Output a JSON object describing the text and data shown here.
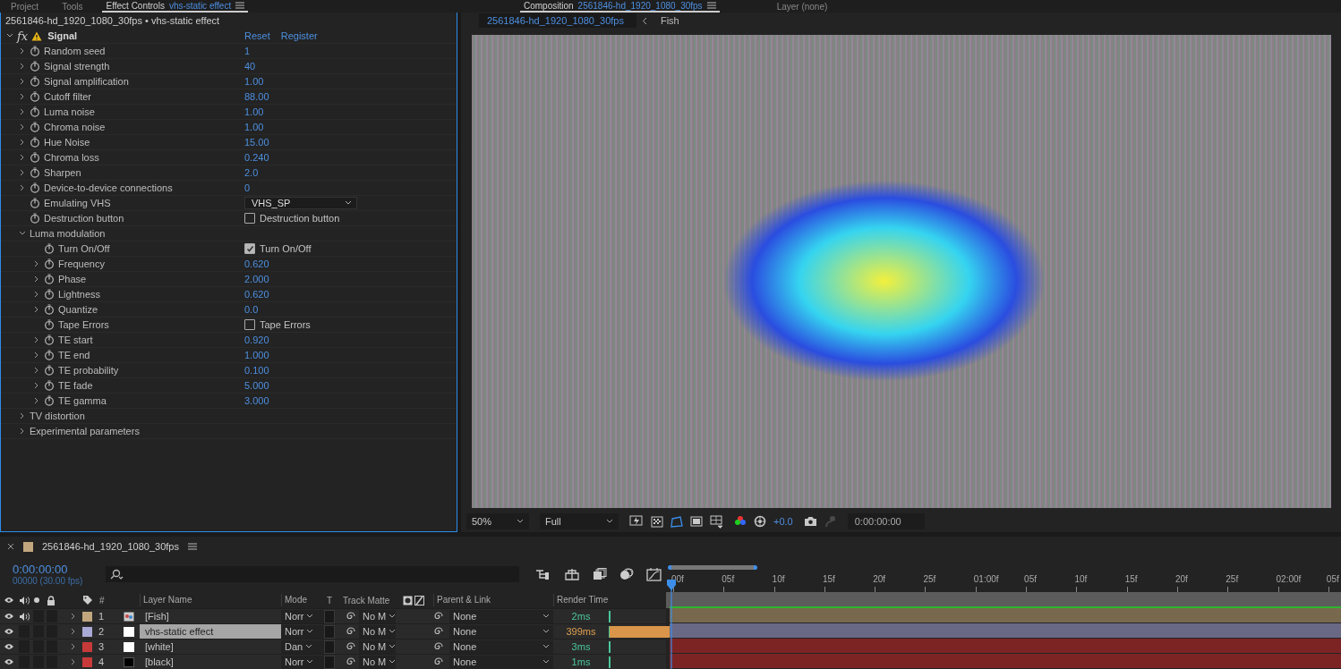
{
  "top_tabs": [
    {
      "label": "Project",
      "selected": false
    },
    {
      "label": "Tools",
      "selected": false
    },
    {
      "label": "Effect Controls",
      "subject": "vhs-static effect",
      "selected": true
    }
  ],
  "top_tabs_right": [
    {
      "label": "Composition",
      "subject": "2561846-hd_1920_1080_30fps",
      "selected": true
    },
    {
      "label": "Layer (none)",
      "selected": false
    }
  ],
  "effect_controls": {
    "header": "2561846-hd_1920_1080_30fps • vhs-static effect",
    "effect": {
      "badge": "fx",
      "name": "Signal",
      "expanded": true,
      "warning": true,
      "reset": "Reset",
      "register": "Register",
      "params": [
        {
          "kind": "value",
          "name": "Random seed",
          "value": "1",
          "expanded": false
        },
        {
          "kind": "value",
          "name": "Signal strength",
          "value": "40",
          "expanded": false
        },
        {
          "kind": "value",
          "name": "Signal amplification",
          "value": "1.00",
          "expanded": false
        },
        {
          "kind": "value",
          "name": "Cutoff filter",
          "value": "88.00",
          "expanded": false
        },
        {
          "kind": "value",
          "name": "Luma noise",
          "value": "1.00",
          "expanded": false
        },
        {
          "kind": "value",
          "name": "Chroma noise",
          "value": "1.00",
          "expanded": false
        },
        {
          "kind": "value",
          "name": "Hue Noise",
          "value": "15.00",
          "expanded": false
        },
        {
          "kind": "value",
          "name": "Chroma loss",
          "value": "0.240",
          "expanded": false
        },
        {
          "kind": "value",
          "name": "Sharpen",
          "value": "2.0",
          "expanded": false
        },
        {
          "kind": "value",
          "name": "Device-to-device connections",
          "value": "0",
          "expanded": false
        },
        {
          "kind": "dropdown",
          "name": "Emulating VHS",
          "value": "VHS_SP"
        },
        {
          "kind": "checkbox",
          "name": "Destruction button",
          "label": "Destruction button",
          "checked": false
        },
        {
          "kind": "group",
          "name": "Luma modulation",
          "expanded": true,
          "children": [
            {
              "kind": "checkbox",
              "name": "Turn On/Off",
              "label": "Turn On/Off",
              "checked": true
            },
            {
              "kind": "value",
              "name": "Frequency",
              "value": "0.620",
              "expanded": false
            },
            {
              "kind": "value",
              "name": "Phase",
              "value": "2.000",
              "expanded": false
            },
            {
              "kind": "value",
              "name": "Lightness",
              "value": "0.620",
              "expanded": false
            },
            {
              "kind": "value",
              "name": "Quantize",
              "value": "0.0",
              "expanded": false
            },
            {
              "kind": "checkbox",
              "name": "Tape Errors",
              "label": "Tape Errors",
              "checked": false
            },
            {
              "kind": "value",
              "name": "TE start",
              "value": "0.920",
              "expanded": false
            },
            {
              "kind": "value",
              "name": "TE end",
              "value": "1.000",
              "expanded": false
            },
            {
              "kind": "value",
              "name": "TE probability",
              "value": "0.100",
              "expanded": false
            },
            {
              "kind": "value",
              "name": "TE fade",
              "value": "5.000",
              "expanded": false
            },
            {
              "kind": "value",
              "name": "TE gamma",
              "value": "3.000",
              "expanded": false
            }
          ]
        },
        {
          "kind": "group",
          "name": "TV distortion",
          "expanded": false
        },
        {
          "kind": "group",
          "name": "Experimental parameters",
          "expanded": false
        }
      ]
    }
  },
  "composition": {
    "breadcrumbs": [
      {
        "label": "2561846-hd_1920_1080_30fps",
        "selected": true
      },
      {
        "label": "Fish",
        "selected": false
      }
    ],
    "toolbar": {
      "zoom": "50%",
      "resolution": "Full",
      "exposure": "+0.0",
      "timecode": "0:00:00:00",
      "toggles": [
        {
          "kind": "fast-previews",
          "on": false
        },
        {
          "kind": "transparency-grid",
          "on": false
        },
        {
          "kind": "mask-visibility",
          "on": true
        },
        {
          "kind": "region-of-interest",
          "on": false
        },
        {
          "kind": "guides",
          "on": false
        }
      ],
      "after_toggles": [
        {
          "kind": "channels"
        },
        {
          "kind": "reset-exposure"
        }
      ],
      "snapshot_tools": [
        {
          "kind": "snapshot",
          "disabled": false
        },
        {
          "kind": "show-snapshot",
          "disabled": true
        }
      ]
    }
  },
  "timeline": {
    "title": "2561846-hd_1920_1080_30fps",
    "current_time": "0:00:00:00",
    "fps": "00000 (30.00 fps)",
    "columns": {
      "number": "#",
      "name": "Layer Name",
      "mode": "Mode",
      "t": "T",
      "track_matte": "Track Matte",
      "parent": "Parent & Link",
      "render_time": "Render Time"
    },
    "ruler": [
      "00f",
      "05f",
      "10f",
      "15f",
      "20f",
      "25f",
      "01:00f",
      "05f",
      "10f",
      "15f",
      "20f",
      "25f",
      "02:00f",
      "05f"
    ],
    "layers": [
      {
        "number": "1",
        "color": "#c2a77e",
        "kind": "footage",
        "name": "[Fish]",
        "selected": false,
        "audio": true,
        "solo": false,
        "locked": false,
        "mode": "Norr",
        "track_matte": "No M",
        "parent": "None",
        "render_time": "2ms",
        "level": 0.01
      },
      {
        "number": "2",
        "color": "#a9a9d6",
        "kind": "white-solid",
        "name": "vhs-static effect",
        "selected": true,
        "audio": false,
        "solo": false,
        "locked": false,
        "mode": "Norr",
        "track_matte": "No M",
        "parent": "None",
        "render_time": "399ms",
        "level": 1
      },
      {
        "number": "3",
        "color": "#c83a3a",
        "kind": "white-solid",
        "name": "[white]",
        "selected": false,
        "audio": false,
        "solo": false,
        "locked": false,
        "mode": "Dan",
        "track_matte": "No M",
        "parent": "None",
        "render_time": "3ms",
        "level": 0.01
      },
      {
        "number": "4",
        "color": "#c83a3a",
        "kind": "black-solid",
        "name": "[black]",
        "selected": false,
        "audio": false,
        "solo": false,
        "locked": false,
        "mode": "Norr",
        "track_matte": "No M",
        "parent": "None",
        "render_time": "1ms",
        "level": 0.01
      }
    ]
  }
}
